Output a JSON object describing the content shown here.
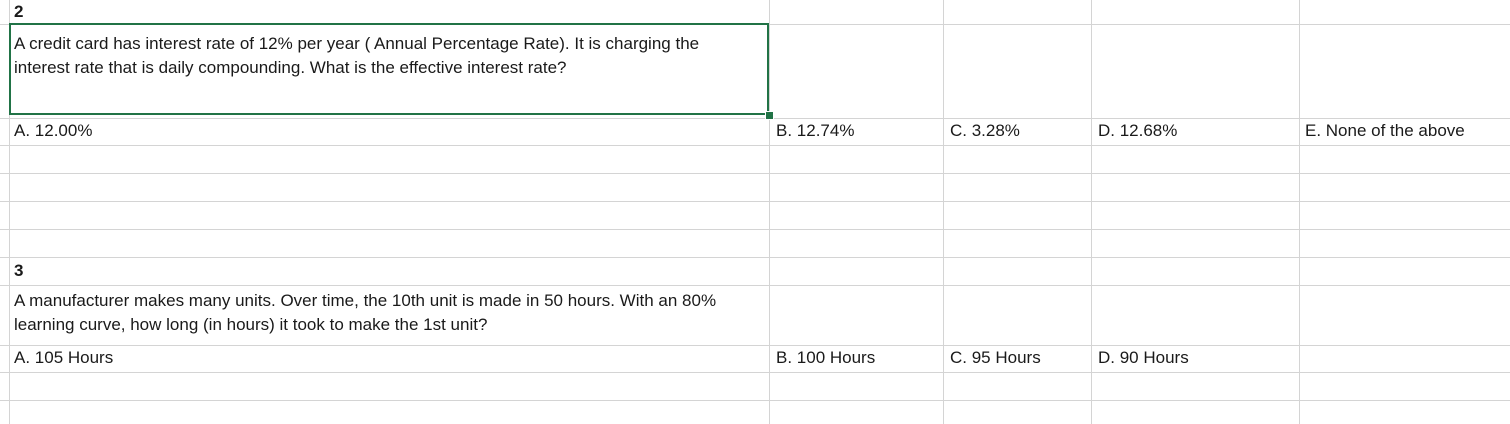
{
  "question_2": {
    "number": "2",
    "text": "A credit card has interest rate of 12% per year ( Annual Percentage Rate). It is charging the interest rate that is daily compounding. What is the effective interest rate?",
    "options": {
      "a": "A. 12.00%",
      "b": "B. 12.74%",
      "c": "C. 3.28%",
      "d": "D. 12.68%",
      "e": "E. None of the above"
    }
  },
  "question_3": {
    "number": "3",
    "text": "A manufacturer makes many units. Over time, the 10th unit is made in 50 hours. With an 80% learning curve, how long (in hours) it took to make the 1st unit?",
    "options": {
      "a": "A. 105 Hours",
      "b": "B. 100 Hours",
      "c": "C. 95 Hours",
      "d": "D. 90 Hours"
    }
  },
  "colors": {
    "selection": "#217346",
    "gridline": "#d4d4d4"
  }
}
